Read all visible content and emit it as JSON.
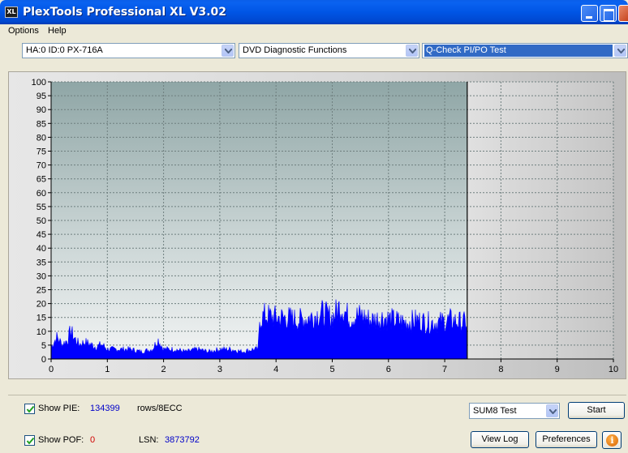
{
  "window": {
    "title": "PlexTools Professional XL V3.02",
    "icon_text": "XL"
  },
  "menu": {
    "items": [
      "Options",
      "Help"
    ]
  },
  "toolbar": {
    "drive": "HA:0 ID:0  PX-716A",
    "function_group": "DVD Diagnostic Functions",
    "test": "Q-Check PI/PO Test"
  },
  "chart_data": {
    "type": "area",
    "title": "",
    "xlabel": "",
    "ylabel": "",
    "x_ticks": [
      "0",
      "1",
      "2",
      "3",
      "4",
      "5",
      "6",
      "7",
      "8",
      "9",
      "10"
    ],
    "y_ticks": [
      "0",
      "5",
      "10",
      "15",
      "20",
      "25",
      "30",
      "35",
      "40",
      "45",
      "50",
      "55",
      "60",
      "65",
      "70",
      "75",
      "80",
      "85",
      "90",
      "95",
      "100"
    ],
    "xlim": [
      0,
      10
    ],
    "ylim": [
      0,
      100
    ],
    "grid": true,
    "marker_x": 7.4,
    "series": [
      {
        "color": "#0000ff",
        "x": [
          0,
          0.1,
          0.2,
          0.3,
          0.35,
          0.4,
          0.5,
          0.6,
          0.7,
          0.8,
          0.9,
          1.0,
          1.2,
          1.4,
          1.6,
          1.8,
          1.9,
          2.0,
          2.2,
          2.4,
          2.6,
          2.8,
          3.0,
          3.2,
          3.4,
          3.6,
          3.69,
          3.7,
          3.8,
          4.0,
          4.2,
          4.4,
          4.6,
          4.8,
          5.0,
          5.15,
          5.3,
          5.5,
          5.7,
          5.9,
          6.1,
          6.3,
          6.5,
          6.7,
          6.9,
          7.1,
          7.3,
          7.4
        ],
        "y": [
          5,
          9,
          6,
          8,
          12,
          9,
          6,
          7,
          6,
          5,
          6,
          4,
          4,
          4,
          3,
          4,
          8,
          4,
          4,
          3,
          4,
          3,
          4,
          4,
          3,
          4,
          4,
          16,
          18,
          17,
          17,
          16,
          17,
          19,
          17,
          22,
          17,
          18,
          16,
          17,
          16,
          15,
          16,
          15,
          15,
          16,
          15,
          15
        ]
      }
    ]
  },
  "bottom": {
    "pie_label": "Show PIE:",
    "pie_value": "134399",
    "pie_unit": "rows/8ECC",
    "pof_label": "Show POF:",
    "pof_value": "0",
    "lsn_label": "LSN:",
    "lsn_value": "3873792",
    "mode_select": "SUM8 Test",
    "start_label": "Start",
    "viewlog_label": "View Log",
    "prefs_label": "Preferences",
    "info_glyph": "i"
  }
}
